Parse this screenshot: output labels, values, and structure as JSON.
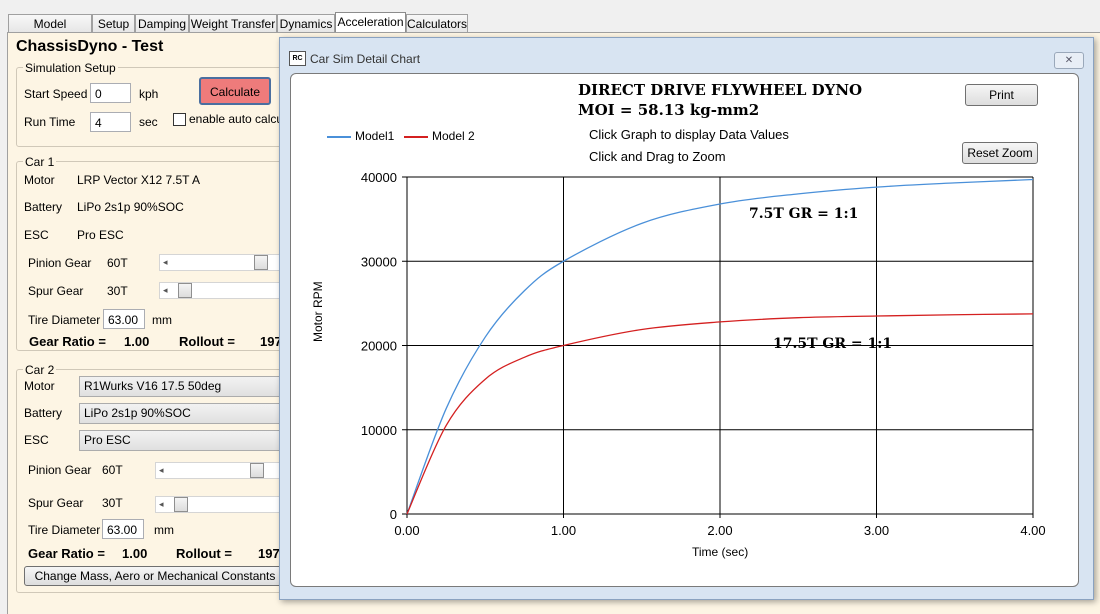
{
  "tabs": [
    "Model Manager",
    "Setup",
    "Damping",
    "Weight Transfer",
    "Dynamics",
    "Acceleration",
    "Calculators"
  ],
  "active_tab": "Acceleration",
  "page_title": "ChassisDyno - Test",
  "sim_setup": {
    "group_label": "Simulation Setup",
    "start_speed_label": "Start Speed",
    "start_speed_value": "0",
    "start_speed_unit": "kph",
    "run_time_label": "Run Time",
    "run_time_value": "4",
    "run_time_unit": "sec",
    "calculate_label": "Calculate",
    "auto_calc_label": "enable auto calcula"
  },
  "car1": {
    "group_label": "Car 1",
    "motor_label": "Motor",
    "motor_value": "LRP Vector X12 7.5T A",
    "battery_label": "Battery",
    "battery_value": "LiPo 2s1p 90%SOC",
    "esc_label": "ESC",
    "esc_value": "Pro ESC",
    "pinion_label": "Pinion Gear",
    "pinion_value": "60T",
    "spur_label": "Spur Gear",
    "spur_value": "30T",
    "tire_label": "Tire Diameter",
    "tire_value": "63.00",
    "tire_unit": "mm",
    "gear_ratio_label": "Gear Ratio =",
    "gear_ratio_value": "1.00",
    "rollout_label": "Rollout =",
    "rollout_value": "197"
  },
  "car2": {
    "group_label": "Car 2",
    "motor_label": "Motor",
    "motor_value": "R1Wurks V16 17.5 50deg",
    "battery_label": "Battery",
    "battery_value": "LiPo 2s1p 90%SOC",
    "esc_label": "ESC",
    "esc_value": "Pro ESC",
    "pinion_label": "Pinion Gear",
    "pinion_value": "60T",
    "spur_label": "Spur Gear",
    "spur_value": "30T",
    "tire_label": "Tire Diameter",
    "tire_value": "63.00",
    "tire_unit": "mm",
    "gear_ratio_label": "Gear Ratio =",
    "gear_ratio_value": "1.00",
    "rollout_label": "Rollout =",
    "rollout_value": "197"
  },
  "change_constants_label": "Change Mass, Aero or Mechanical Constants",
  "chart_window": {
    "title": "Car Sim Detail Chart",
    "close_glyph": "✕",
    "print_label": "Print",
    "reset_zoom_label": "Reset Zoom",
    "hint1": "Click Graph to display Data Values",
    "hint2": "Click and Drag to Zoom"
  },
  "colors": {
    "model1": "#4a90d9",
    "model2": "#d42020",
    "calculate_btn": "#ee7b7b"
  },
  "chart_data": {
    "type": "line",
    "title": "DIRECT DRIVE FLYWHEEL DYNO",
    "subtitle": "MOI = 58.13 kg-mm2",
    "xlabel": "Time (sec)",
    "ylabel": "Motor RPM",
    "xlim": [
      0,
      4
    ],
    "ylim": [
      0,
      40000
    ],
    "x_ticks": [
      "0.00",
      "1.00",
      "2.00",
      "3.00",
      "4.00"
    ],
    "y_ticks": [
      "0",
      "10000",
      "20000",
      "30000",
      "40000"
    ],
    "grid": true,
    "legend_position": "top-left",
    "annotations": [
      "7.5T GR = 1:1",
      "17.5T GR = 1:1"
    ],
    "series": [
      {
        "name": "Model1",
        "x": [
          0,
          0.25,
          0.5,
          0.75,
          1.0,
          1.5,
          2.0,
          2.5,
          3.0,
          3.5,
          4.0
        ],
        "y": [
          0,
          12500,
          21000,
          26500,
          30000,
          34500,
          36800,
          38000,
          38800,
          39300,
          39700
        ]
      },
      {
        "name": "Model 2",
        "x": [
          0,
          0.25,
          0.5,
          0.75,
          1.0,
          1.5,
          2.0,
          2.5,
          3.0,
          3.5,
          4.0
        ],
        "y": [
          0,
          10500,
          16000,
          18600,
          20000,
          21900,
          22800,
          23300,
          23500,
          23650,
          23750
        ]
      }
    ]
  }
}
